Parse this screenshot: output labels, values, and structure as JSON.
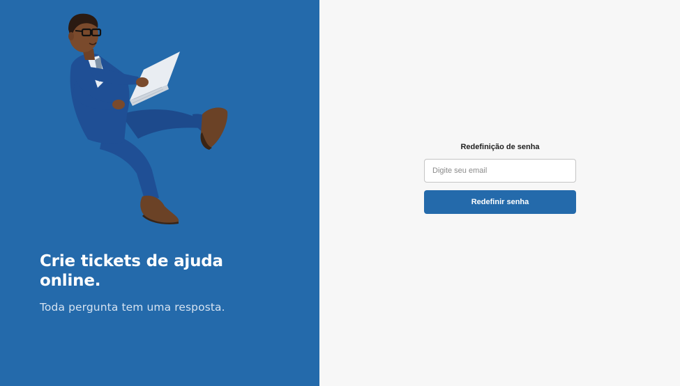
{
  "left_panel": {
    "illustration": "businessman-flying-with-laptop",
    "title": "Crie tickets de ajuda online.",
    "subtitle": "Toda pergunta tem uma resposta."
  },
  "form": {
    "title": "Redefinição de senha",
    "email_placeholder": "Digite seu email",
    "email_value": "",
    "submit_label": "Redefinir senha"
  },
  "colors": {
    "brand_blue": "#246aab",
    "right_background": "#f7f7f7"
  }
}
